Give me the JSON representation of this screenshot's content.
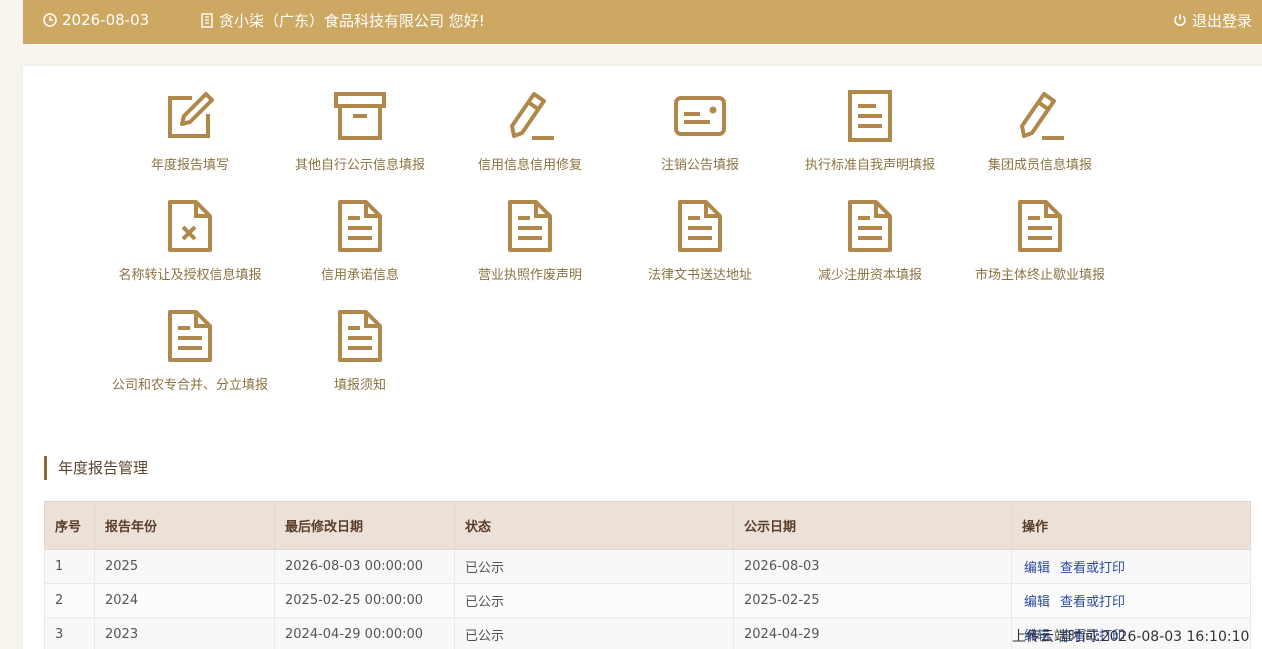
{
  "header": {
    "date": "2026-08-03",
    "greeting": "贪小柒（广东）食品科技有限公司 您好!",
    "logout_label": "退出登录"
  },
  "menu": [
    {
      "label": "年度报告填写",
      "icon": "edit-icon"
    },
    {
      "label": "其他自行公示信息填报",
      "icon": "archive-box-icon"
    },
    {
      "label": "信用信息信用修复",
      "icon": "pencil-icon"
    },
    {
      "label": "注销公告填报",
      "icon": "card-icon"
    },
    {
      "label": "执行标准自我声明填报",
      "icon": "document-icon"
    },
    {
      "label": "集团成员信息填报",
      "icon": "pencil-icon"
    },
    {
      "label": "名称转让及授权信息填报",
      "icon": "document-x-icon"
    },
    {
      "label": "信用承诺信息",
      "icon": "document-lines-icon"
    },
    {
      "label": "营业执照作废声明",
      "icon": "document-lines-icon"
    },
    {
      "label": "法律文书送达地址",
      "icon": "document-lines-icon"
    },
    {
      "label": "减少注册资本填报",
      "icon": "document-lines-icon"
    },
    {
      "label": "市场主体终止歇业填报",
      "icon": "document-lines-icon"
    },
    {
      "label": "公司和农专合并、分立填报",
      "icon": "document-lines-icon"
    },
    {
      "label": "填报须知",
      "icon": "document-lines-icon"
    }
  ],
  "annual_report": {
    "title": "年度报告管理",
    "columns": [
      "序号",
      "报告年份",
      "最后修改日期",
      "状态",
      "公示日期",
      "操作"
    ],
    "rows": [
      {
        "no": "1",
        "year": "2025",
        "modified": "2026-08-03 00:00:00",
        "status": "已公示",
        "published": "2026-08-03",
        "edit": "编辑",
        "view": "查看或打印"
      },
      {
        "no": "2",
        "year": "2024",
        "modified": "2025-02-25 00:00:00",
        "status": "已公示",
        "published": "2025-02-25",
        "edit": "编辑",
        "view": "查看或打印"
      },
      {
        "no": "3",
        "year": "2023",
        "modified": "2024-04-29 00:00:00",
        "status": "已公示",
        "published": "2024-04-29",
        "edit": "编辑",
        "view": "查看或打印"
      }
    ]
  },
  "footer": {
    "timestamp": "上传云端时间:2026-08-03 16:10:10"
  },
  "colors": {
    "brand": "#cda862",
    "icon": "#b0894a"
  }
}
